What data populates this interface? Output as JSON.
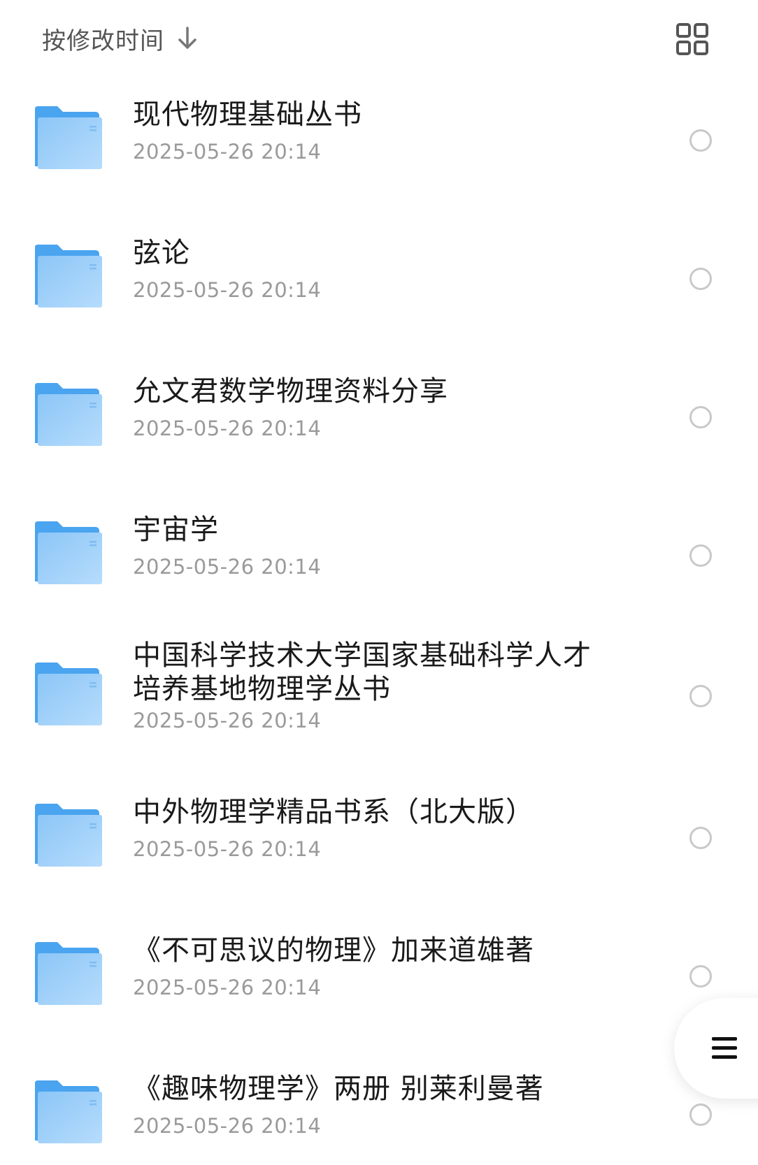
{
  "sort": {
    "label": "按修改时间",
    "arrow_icon": "arrow-down-icon"
  },
  "view_toggle_icon": "grid-view-icon",
  "menu_icon": "menu-icon",
  "folder_icon": "folder-icon",
  "colors": {
    "folder_light": "#a9d6fb",
    "folder_dark": "#4aa4ef",
    "title": "#1a1a1a",
    "date": "#9a9a9a",
    "radio_border": "#c9c9c9"
  },
  "items": [
    {
      "name": "现代物理基础丛书",
      "modified": "2025-05-26 20:14"
    },
    {
      "name": "弦论",
      "modified": "2025-05-26 20:14"
    },
    {
      "name": "允文君数学物理资料分享",
      "modified": "2025-05-26 20:14"
    },
    {
      "name": "宇宙学",
      "modified": "2025-05-26 20:14"
    },
    {
      "name": "中国科学技术大学国家基础科学人才培养基地物理学丛书",
      "modified": "2025-05-26 20:14"
    },
    {
      "name": "中外物理学精品书系（北大版）",
      "modified": "2025-05-26 20:14"
    },
    {
      "name": "《不可思议的物理》加来道雄著",
      "modified": "2025-05-26 20:14"
    },
    {
      "name": "《趣味物理学》两册 别莱利曼著",
      "modified": "2025-05-26 20:14"
    }
  ]
}
